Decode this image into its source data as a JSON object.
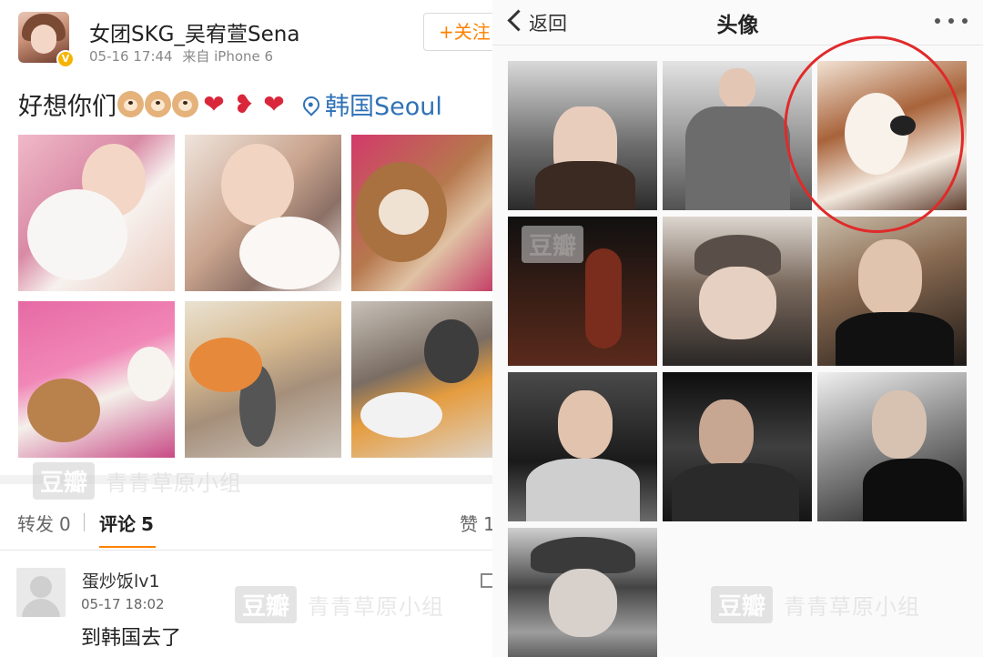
{
  "left": {
    "username": "女团SKG_吴宥萱Sena",
    "date": "05-16 17:44",
    "source": "来自 iPhone 6",
    "follow_label": "+关注",
    "post_text": "好想你们",
    "location": "韩国Seoul",
    "emoji_icons": [
      "dog-face-icon",
      "dog-face-icon",
      "dog-face-icon",
      "heart-icon",
      "broken-heart-icon",
      "heart-icon"
    ],
    "photo_count": 6,
    "stats": {
      "repost_label": "转发",
      "repost_count": "0",
      "comment_label": "评论",
      "comment_count": "5",
      "like_label": "赞",
      "like_count": "1"
    },
    "comment": {
      "author": "蛋炒饭lv1",
      "time": "05-17 18:02",
      "text": "到韩国去了"
    }
  },
  "right": {
    "back_label": "返回",
    "title": "头像",
    "photo_count": 10,
    "highlight_color": "#e02a2a"
  },
  "watermark": {
    "badge": "豆瓣",
    "text": "青青草原小组"
  },
  "colors": {
    "accent_orange": "#ff8200",
    "link_blue": "#3072b6",
    "verified_gold": "#f6b400"
  }
}
